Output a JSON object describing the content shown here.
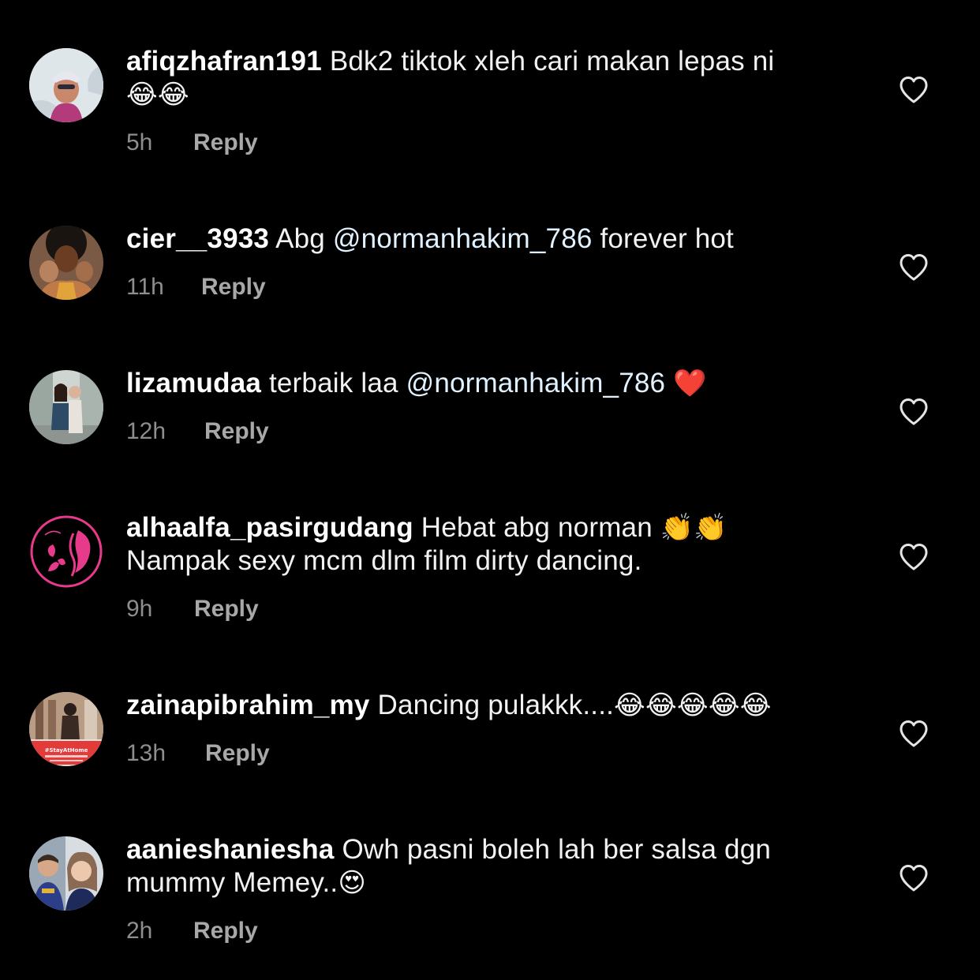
{
  "comments": [
    {
      "username": "afiqzhafran191",
      "text": "Bdk2 tiktok xleh cari makan lepas ni",
      "line2": "😂😂",
      "time": "5h",
      "reply": "Reply"
    },
    {
      "username": "cier__3933",
      "text_before": "Abg",
      "mention": "@normanhakim_786",
      "text_after": "forever hot",
      "time": "11h",
      "reply": "Reply"
    },
    {
      "username": "lizamudaa",
      "text_before": "terbaik laa",
      "mention": "@normanhakim_786",
      "emoji": "❤️",
      "time": "12h",
      "reply": "Reply"
    },
    {
      "username": "alhaalfa_pasirgudang",
      "text": "Hebat abg norman",
      "emoji": "👏👏",
      "line2": "Nampak sexy mcm dlm film dirty dancing.",
      "time": "9h",
      "reply": "Reply"
    },
    {
      "username": "zainapibrahim_my",
      "text": "Dancing pulakkk....",
      "emoji": "😂😂😂😂😂",
      "time": "13h",
      "reply": "Reply",
      "avatar_caption": "#StayAtHome"
    },
    {
      "username": "aanieshaniesha",
      "text": "Owh pasni boleh lah ber salsa dgn",
      "line2": "mummy Memey..",
      "emoji": "😍",
      "time": "2h",
      "reply": "Reply"
    }
  ]
}
